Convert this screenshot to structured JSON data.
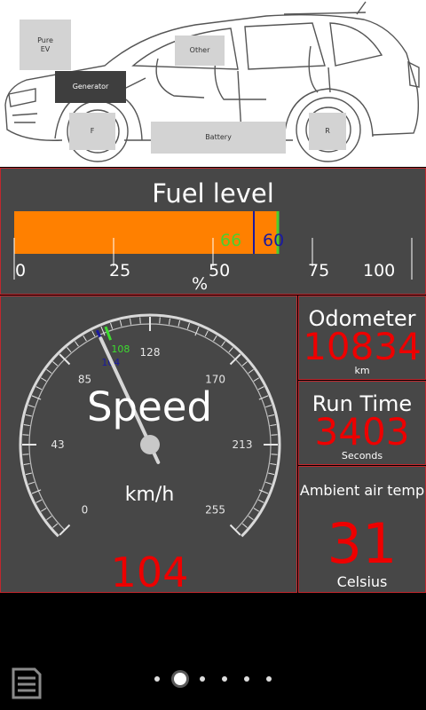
{
  "energy_flow": {
    "pure_ev": "Pure\nEV",
    "generator": "Generator",
    "other": "Other",
    "front": "F",
    "battery": "Battery",
    "rear": "R"
  },
  "fuel": {
    "title": "Fuel level",
    "level_green": "66",
    "level_blue": "60",
    "unit": "%",
    "ticks": [
      "0",
      "25",
      "50",
      "75",
      "100"
    ],
    "fill_percent": 66,
    "fill_color": "#ff8000"
  },
  "speed": {
    "label": "Speed",
    "unit": "km/h",
    "value": "104",
    "marker_blue": "104",
    "marker_green": "108",
    "scale_labels": [
      "0",
      "43",
      "85",
      "128",
      "170",
      "213",
      "255"
    ],
    "value_color": "#e00000"
  },
  "odometer": {
    "title": "Odometer",
    "value": "10834",
    "unit": "km"
  },
  "run_time": {
    "title": "Run Time",
    "value": "3403",
    "unit": "Seconds"
  },
  "ambient": {
    "title": "Ambient air temp",
    "value": "31",
    "unit": "Celsius"
  },
  "colors": {
    "panel": "#474747",
    "border": "#c1272d",
    "accent_red": "#e00000",
    "fuel_orange": "#ff8000"
  }
}
